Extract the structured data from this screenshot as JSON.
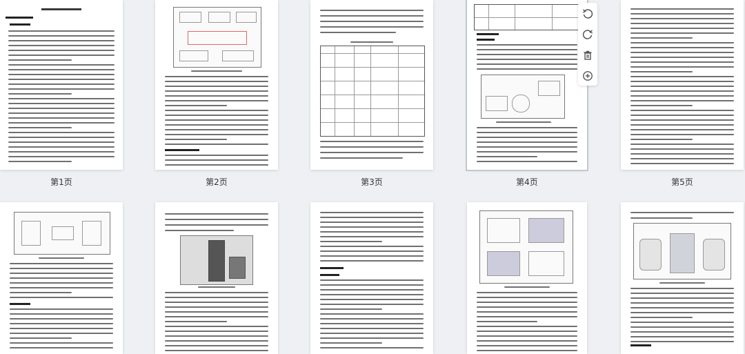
{
  "pages": [
    {
      "label": "第1页"
    },
    {
      "label": "第2页"
    },
    {
      "label": "第3页"
    },
    {
      "label": "第4页"
    },
    {
      "label": "第5页"
    }
  ],
  "selected_page": 4,
  "toolbar": {
    "icons": [
      "rotate-left-icon",
      "rotate-right-icon",
      "delete-icon",
      "add-icon"
    ]
  }
}
